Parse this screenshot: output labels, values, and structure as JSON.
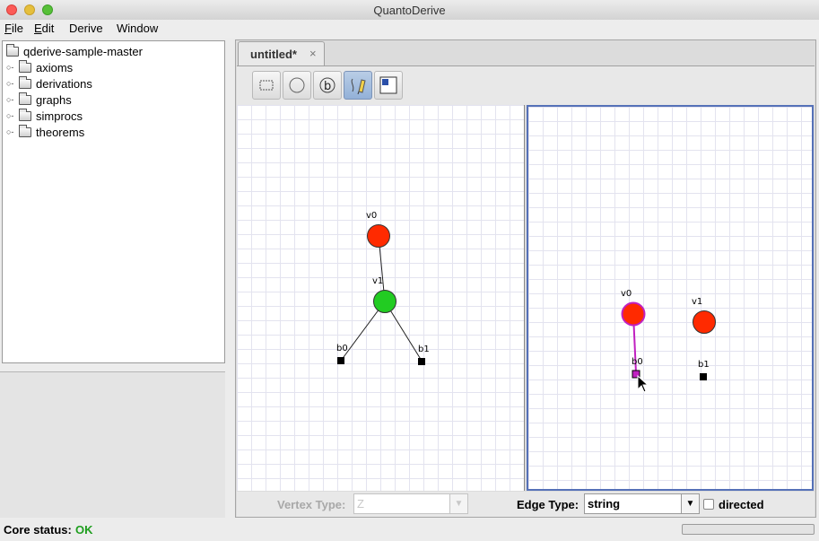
{
  "window": {
    "title": "QuantoDerive",
    "close_color": "#fc5b57",
    "minimize_color": "#e5bf3c",
    "zoom_color": "#57c038"
  },
  "menu": [
    {
      "label_u": "F",
      "label_rest": "ile"
    },
    {
      "label_u": "E",
      "label_rest": "dit"
    },
    {
      "label_u": "",
      "label_rest": "Derive"
    },
    {
      "label_u": "",
      "label_rest": "Window"
    }
  ],
  "tree": {
    "root": "qderive-sample-master",
    "items": [
      {
        "label": "axioms"
      },
      {
        "label": "derivations"
      },
      {
        "label": "graphs"
      },
      {
        "label": "simprocs"
      },
      {
        "label": "theorems"
      }
    ]
  },
  "tab": {
    "label": "untitled*",
    "close": "×"
  },
  "toolbar": {
    "tools": [
      {
        "icon": "select-rectangle-icon",
        "active": false
      },
      {
        "icon": "add-vertex-icon",
        "active": false
      },
      {
        "icon": "add-boundary-icon",
        "active": false
      },
      {
        "icon": "add-edge-pen-icon",
        "active": true
      },
      {
        "icon": "bang-box-icon",
        "active": false
      }
    ]
  },
  "left_graph": {
    "vertices": [
      {
        "name": "v0",
        "kind": "z",
        "color": "#ff2a00"
      },
      {
        "name": "v1",
        "kind": "x",
        "color": "#22cc22"
      },
      {
        "name": "b0",
        "kind": "boundary",
        "color": "#000000"
      },
      {
        "name": "b1",
        "kind": "boundary",
        "color": "#000000"
      }
    ],
    "edges": [
      [
        "v0",
        "v1"
      ],
      [
        "v1",
        "b0"
      ],
      [
        "v1",
        "b1"
      ]
    ]
  },
  "right_graph": {
    "vertices": [
      {
        "name": "v0",
        "kind": "z",
        "color": "#ff2a00",
        "selected": true
      },
      {
        "name": "v1",
        "kind": "z",
        "color": "#ff2a00"
      },
      {
        "name": "b0",
        "kind": "boundary",
        "color": "#000000",
        "selected": true
      },
      {
        "name": "b1",
        "kind": "boundary",
        "color": "#000000"
      }
    ],
    "edges": [
      [
        "v0",
        "b0"
      ]
    ],
    "highlight_color": "#c020c0"
  },
  "bottom": {
    "vertex_type_label": "Vertex Type:",
    "vertex_type_value": "Z",
    "edge_type_label": "Edge Type:",
    "edge_type_value": "string",
    "directed_label": "directed",
    "directed_checked": false
  },
  "status": {
    "label": "Core status:",
    "value": "OK",
    "value_color": "#1e9e1e"
  }
}
